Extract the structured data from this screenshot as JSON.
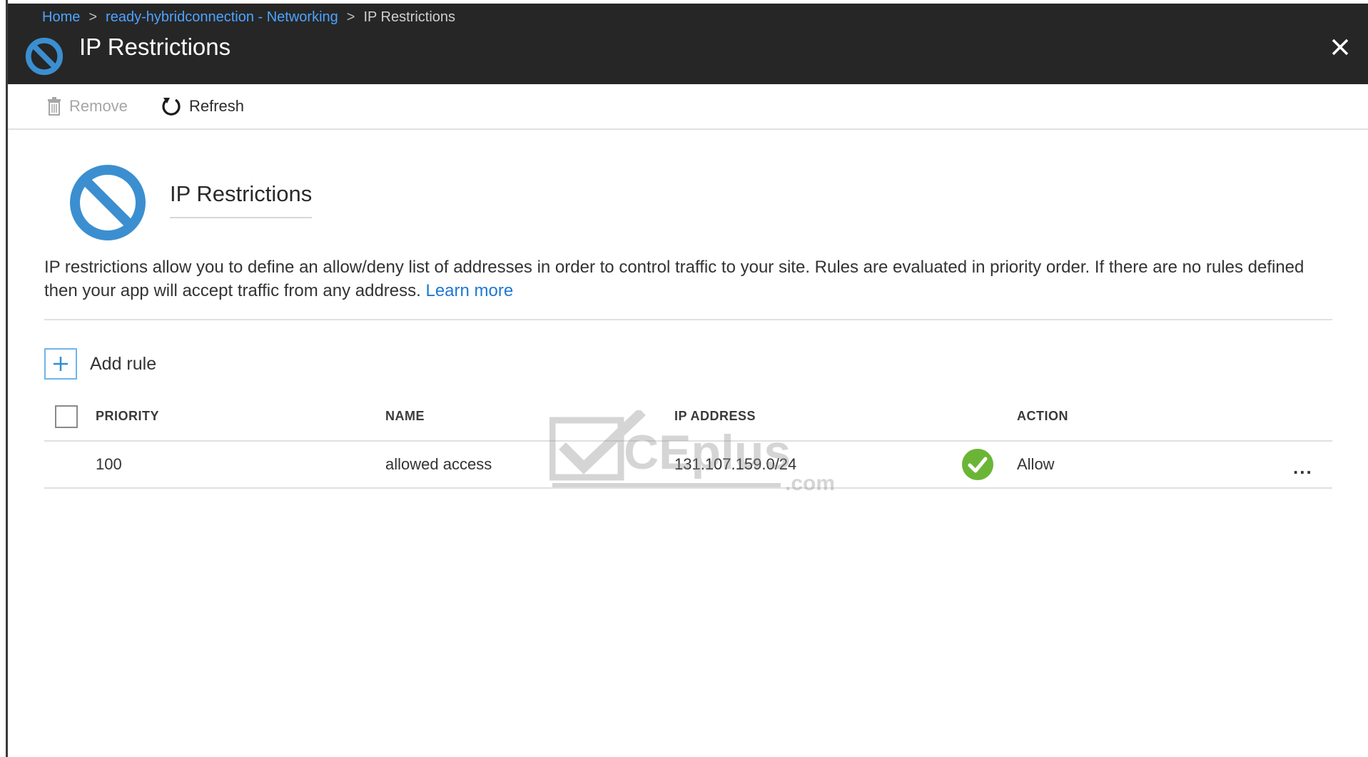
{
  "breadcrumb": {
    "items": [
      "Home",
      "ready-hybridconnection - Networking",
      "IP Restrictions"
    ],
    "separator": ">"
  },
  "blade": {
    "title": "IP Restrictions",
    "close_icon": "close-icon"
  },
  "toolbar": {
    "remove_label": "Remove",
    "refresh_label": "Refresh"
  },
  "intro": {
    "title": "IP Restrictions",
    "description": "IP restrictions allow you to define an allow/deny list of addresses in order to control traffic to your site. Rules are evaluated in priority order. If there are no rules defined then your app will accept traffic from any address.",
    "learn_more": "Learn more"
  },
  "add_rule_label": "Add rule",
  "table": {
    "columns": [
      "PRIORITY",
      "NAME",
      "IP ADDRESS",
      "ACTION"
    ],
    "rows": [
      {
        "priority": "100",
        "name": "allowed access",
        "ip_address": "131.107.159.0/24",
        "action": "Allow",
        "more": "..."
      }
    ]
  },
  "watermark": {
    "brand": "CEplus",
    "suffix": ".com"
  },
  "colors": {
    "header_bg": "#262626",
    "accent_blue": "#3b8fd0",
    "link_blue": "#1f78d1",
    "allow_green": "#6bb536"
  }
}
